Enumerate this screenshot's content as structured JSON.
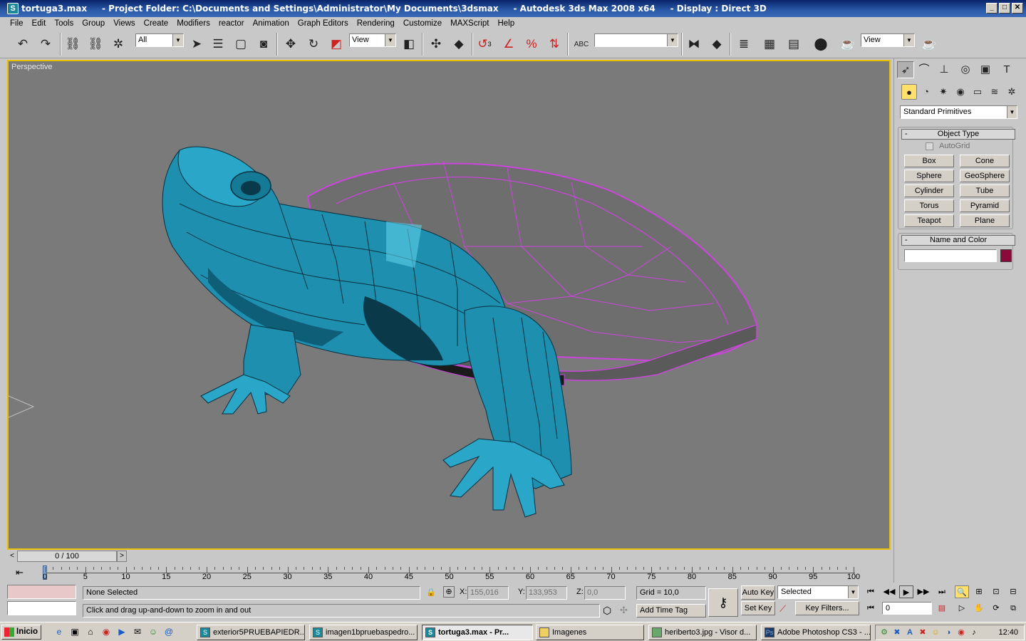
{
  "window": {
    "title": "tortuga3.max     - Project Folder: C:\\Documents and Settings\\Administrator\\My Documents\\3dsmax     - Autodesk 3ds Max 2008 x64     - Display : Direct 3D",
    "min": "_",
    "max": "□",
    "close": "✕"
  },
  "menu": [
    "File",
    "Edit",
    "Tools",
    "Group",
    "Views",
    "Create",
    "Modifiers",
    "reactor",
    "Animation",
    "Graph Editors",
    "Rendering",
    "Customize",
    "MAXScript",
    "Help"
  ],
  "toolbar": {
    "selection_filter": "All",
    "ref_coord": "View",
    "named_selection": "",
    "render_view": "View",
    "snap_angle_label": "3",
    "abc_label": "ABC"
  },
  "viewport": {
    "label": "Perspective",
    "accent": "#e8c000",
    "model_color": "#1f8fb0",
    "shell_wire_color": "#cc44dd"
  },
  "command_panel": {
    "dropdown": "Standard Primitives",
    "object_type": {
      "title": "Object Type",
      "autogrid": "AutoGrid",
      "buttons": [
        "Box",
        "Cone",
        "Sphere",
        "GeoSphere",
        "Cylinder",
        "Tube",
        "Torus",
        "Pyramid",
        "Teapot",
        "Plane"
      ]
    },
    "name_color": {
      "title": "Name and Color",
      "name": "",
      "color": "#8a0a3a"
    },
    "collapse": "-"
  },
  "timeline": {
    "slider": "0 / 100",
    "left": "<",
    "right": ">",
    "ticks": [
      "0",
      "5",
      "10",
      "15",
      "20",
      "25",
      "30",
      "35",
      "40",
      "45",
      "50",
      "55",
      "60",
      "65",
      "70",
      "75",
      "80",
      "85",
      "90",
      "95",
      "100"
    ]
  },
  "status": {
    "selection": "None Selected",
    "prompt": "Click and drag up-and-down to zoom in and out",
    "x_label": "X:",
    "x": "155,016",
    "y_label": "Y:",
    "y": "133,953",
    "z_label": "Z:",
    "z": "0,0",
    "grid": "Grid = 10,0",
    "add_time_tag": "Add Time Tag",
    "auto_key": "Auto Key",
    "set_key": "Set Key",
    "key_filter_select": "Selected",
    "key_filters": "Key Filters...",
    "frame": "0"
  },
  "taskbar": {
    "start": "Inicio",
    "tasks": [
      {
        "label": "exterior5PRUEBAPIEDR...",
        "icon": "3ds"
      },
      {
        "label": "imagen1bpruebaspedro...",
        "icon": "3ds"
      },
      {
        "label": "tortuga3.max     - Pr...",
        "icon": "3ds",
        "active": true
      },
      {
        "label": "Imagenes",
        "icon": "folder"
      },
      {
        "label": "heriberto3.jpg - Visor d...",
        "icon": "img"
      },
      {
        "label": "Adobe Photoshop CS3 - ...",
        "icon": "Ps"
      }
    ],
    "clock": "12:40"
  }
}
